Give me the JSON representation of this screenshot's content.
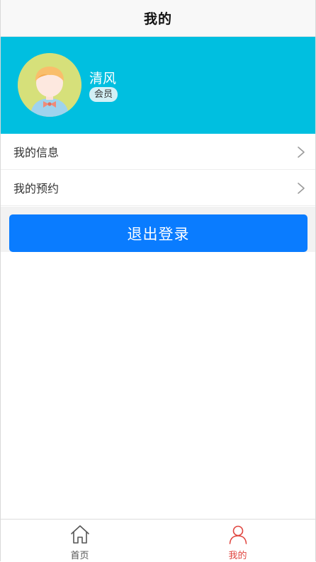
{
  "header": {
    "title": "我的"
  },
  "profile": {
    "username": "清风",
    "badge": "会员"
  },
  "menu": {
    "items": [
      {
        "label": "我的信息",
        "icon": "chevron-right-icon"
      },
      {
        "label": "我的预约",
        "icon": "chevron-right-icon"
      }
    ]
  },
  "logout": {
    "label": "退出登录"
  },
  "tabbar": {
    "tabs": [
      {
        "label": "首页",
        "icon": "home-icon",
        "active": false
      },
      {
        "label": "我的",
        "icon": "user-icon",
        "active": true
      }
    ]
  },
  "colors": {
    "banner": "#00bfe0",
    "primary_button": "#0a7cff",
    "active_tab": "#e0453f"
  }
}
